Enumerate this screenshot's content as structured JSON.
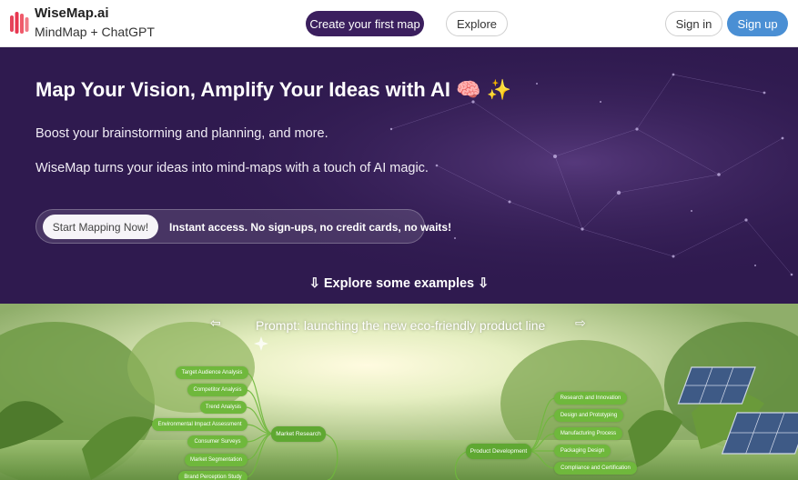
{
  "header": {
    "brand_name": "WiseMap.ai",
    "brand_tagline": "MindMap + ChatGPT",
    "nav": {
      "create_label": "Create your first map",
      "explore_label": "Explore",
      "signin_label": "Sign in",
      "signup_label": "Sign up"
    }
  },
  "hero": {
    "title": "Map Your Vision, Amplify Your Ideas with AI",
    "title_emoji": "🧠 ✨",
    "subtitle_1": "Boost your brainstorming and planning, and more.",
    "subtitle_2": "WiseMap turns your ideas into mind-maps with a touch of AI magic.",
    "cta_button": "Start Mapping Now!",
    "cta_note": "Instant access. No sign-ups, no credit cards, no waits!",
    "explore_examples": "⇩ Explore some examples ⇩"
  },
  "example": {
    "prompt": "Prompt: launching the new eco-friendly product line",
    "arrow_left": "⇦",
    "arrow_right": "⇨",
    "left_branch": {
      "main": "Market Research",
      "children": [
        "Target Audience Analysis",
        "Competitor Analysis",
        "Trend Analysis",
        "Environmental Impact Assessment",
        "Consumer Surveys",
        "Market Segmentation",
        "Brand Perception Study"
      ]
    },
    "right_branch": {
      "main": "Product Development",
      "children": [
        "Research and Innovation",
        "Design and Prototyping",
        "Manufacturing Process",
        "Packaging Design",
        "Compliance and Certification"
      ]
    }
  },
  "colors": {
    "brand_dark": "#3b1f5e",
    "signup_blue": "#4a8fd4",
    "hero_bg": "#2f1a4f",
    "node_green": "#6fb83c"
  }
}
